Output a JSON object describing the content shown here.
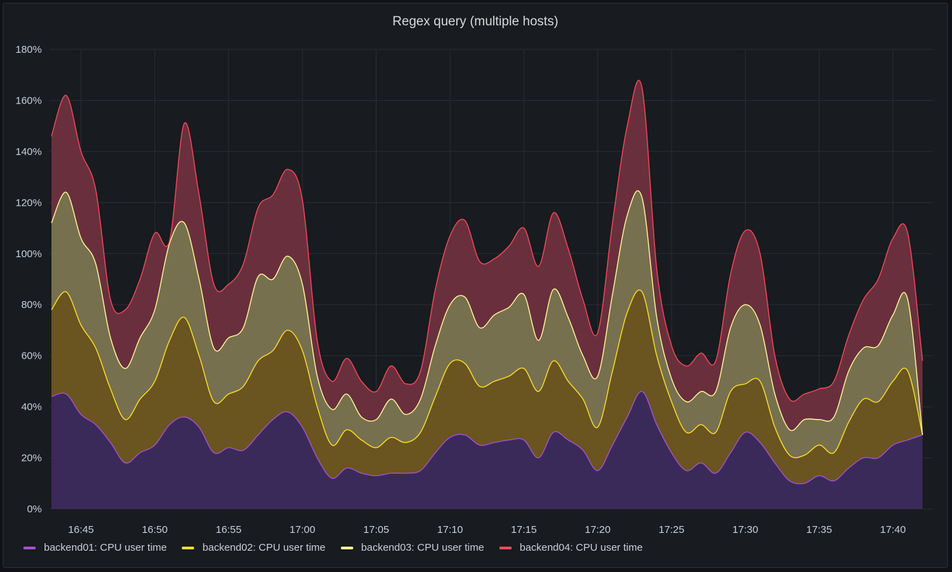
{
  "panel": {
    "title": "Regex query (multiple hosts)"
  },
  "chart_data": {
    "type": "area",
    "stacked": true,
    "title": "Regex query (multiple hosts)",
    "x": [
      "16:43",
      "16:44",
      "16:45",
      "16:46",
      "16:47",
      "16:48",
      "16:49",
      "16:50",
      "16:51",
      "16:52",
      "16:53",
      "16:54",
      "16:55",
      "16:56",
      "16:57",
      "16:58",
      "16:59",
      "17:00",
      "17:01",
      "17:02",
      "17:03",
      "17:04",
      "17:05",
      "17:06",
      "17:07",
      "17:08",
      "17:09",
      "17:10",
      "17:11",
      "17:12",
      "17:13",
      "17:14",
      "17:15",
      "17:16",
      "17:17",
      "17:18",
      "17:19",
      "17:20",
      "17:21",
      "17:22",
      "17:23",
      "17:24",
      "17:25",
      "17:26",
      "17:27",
      "17:28",
      "17:29",
      "17:30",
      "17:31",
      "17:32",
      "17:33",
      "17:34",
      "17:35",
      "17:36",
      "17:37",
      "17:38",
      "17:39",
      "17:40",
      "17:41",
      "17:42"
    ],
    "x_ticks": [
      "16:45",
      "16:50",
      "16:55",
      "17:00",
      "17:05",
      "17:10",
      "17:15",
      "17:20",
      "17:25",
      "17:30",
      "17:35",
      "17:40"
    ],
    "y_ticks": [
      "0%",
      "20%",
      "40%",
      "60%",
      "80%",
      "100%",
      "120%",
      "140%",
      "160%",
      "180%"
    ],
    "ylim": [
      0,
      180
    ],
    "y_unit": "%",
    "grid": true,
    "legend_position": "bottom-left",
    "series": [
      {
        "name": "backend01: CPU user time",
        "color": "#a352cc",
        "fill": "#3a2a5a",
        "values": [
          44,
          45,
          37,
          33,
          26,
          18,
          22,
          25,
          33,
          36,
          32,
          22,
          24,
          23,
          29,
          35,
          38,
          32,
          20,
          12,
          16,
          14,
          13,
          14,
          14,
          15,
          22,
          28,
          29,
          25,
          26,
          27,
          27,
          20,
          30,
          27,
          23,
          15,
          25,
          36,
          46,
          33,
          22,
          15,
          18,
          14,
          22,
          30,
          26,
          18,
          11,
          10,
          13,
          11,
          16,
          20,
          20,
          25,
          27,
          29
        ]
      },
      {
        "name": "backend02: CPU user time",
        "color": "#fade2a",
        "fill": "#6a5420",
        "values": [
          78,
          85,
          72,
          63,
          47,
          35,
          43,
          50,
          66,
          75,
          60,
          42,
          45,
          48,
          58,
          62,
          70,
          62,
          40,
          25,
          31,
          27,
          24,
          28,
          26,
          30,
          44,
          57,
          57,
          48,
          50,
          52,
          55,
          46,
          58,
          50,
          43,
          32,
          54,
          77,
          85,
          60,
          42,
          30,
          33,
          30,
          46,
          49,
          50,
          32,
          21,
          21,
          25,
          22,
          34,
          43,
          42,
          50,
          54,
          29
        ]
      },
      {
        "name": "backend03: CPU user time",
        "color": "#fff899",
        "fill": "#77704e",
        "values": [
          112,
          124,
          106,
          96,
          67,
          55,
          67,
          78,
          104,
          112,
          90,
          63,
          67,
          71,
          91,
          90,
          99,
          88,
          52,
          39,
          45,
          36,
          35,
          43,
          37,
          43,
          64,
          80,
          83,
          71,
          76,
          79,
          84,
          66,
          86,
          75,
          60,
          52,
          84,
          115,
          122,
          75,
          51,
          42,
          46,
          46,
          71,
          80,
          72,
          45,
          31,
          35,
          35,
          36,
          54,
          63,
          64,
          76,
          82,
          29
        ]
      },
      {
        "name": "backend04: CPU user time",
        "color": "#f2495c",
        "fill": "#6a2f3d",
        "values": [
          146,
          162,
          140,
          125,
          82,
          78,
          90,
          108,
          105,
          151,
          123,
          88,
          88,
          96,
          118,
          123,
          133,
          121,
          66,
          50,
          59,
          50,
          46,
          56,
          49,
          54,
          86,
          107,
          113,
          97,
          98,
          103,
          110,
          95,
          116,
          102,
          82,
          69,
          112,
          150,
          165,
          94,
          64,
          56,
          61,
          58,
          92,
          109,
          100,
          60,
          43,
          45,
          47,
          50,
          68,
          82,
          90,
          106,
          108,
          58
        ]
      }
    ]
  }
}
